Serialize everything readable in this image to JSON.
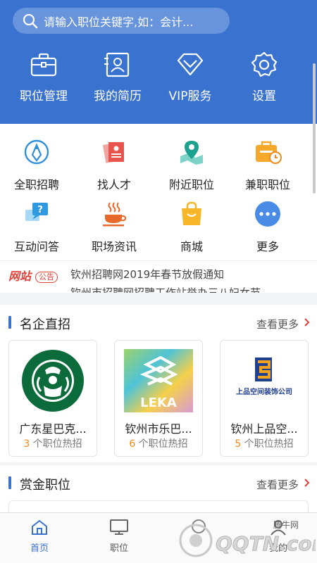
{
  "search": {
    "placeholder": "请输入职位关键字,如：会计..."
  },
  "top_nav": [
    {
      "label": "职位管理",
      "icon": "briefcase-icon"
    },
    {
      "label": "我的简历",
      "icon": "resume-icon"
    },
    {
      "label": "VIP服务",
      "icon": "diamond-icon"
    },
    {
      "label": "设置",
      "icon": "gear-icon"
    }
  ],
  "shortcuts": [
    {
      "label": "全职招聘",
      "icon": "fulltime-icon"
    },
    {
      "label": "找人才",
      "icon": "talent-icon"
    },
    {
      "label": "附近职位",
      "icon": "map-pin-icon"
    },
    {
      "label": "兼职职位",
      "icon": "parttime-icon"
    },
    {
      "label": "互动问答",
      "icon": "qa-icon"
    },
    {
      "label": "职场资讯",
      "icon": "coffee-icon"
    },
    {
      "label": "商城",
      "icon": "shopping-bag-icon"
    },
    {
      "label": "更多",
      "icon": "more-icon"
    }
  ],
  "notice": {
    "badge_main": "网站",
    "badge_sub": "公告",
    "text": "钦州招聘网2019年春节放假通知",
    "text_next": "钦州市招聘网招聘工作站举办三八妇女节"
  },
  "famous": {
    "title": "名企直招",
    "more": "查看更多",
    "companies": [
      {
        "name": "广东星巴克...",
        "count": "3",
        "suffix": " 个职位热招"
      },
      {
        "name": "钦州市乐巴...",
        "count": "6",
        "suffix": " 个职位热招"
      },
      {
        "name": "钦州上品空...",
        "count": "5",
        "suffix": " 个职位热招"
      }
    ],
    "logo_texts": {
      "leka": "LEKA",
      "shangpin": "上品空间装饰公司"
    }
  },
  "bounty": {
    "title": "赏金职位",
    "more": "查看更多"
  },
  "bottom_nav": [
    {
      "label": "首页",
      "active": true
    },
    {
      "label": "职位",
      "active": false
    },
    {
      "label": "",
      "active": false
    },
    {
      "label": "我的",
      "active": false
    }
  ],
  "watermark": {
    "cn": "腾牛网",
    "en": "QQTN.com"
  },
  "colors": {
    "primary": "#3a72d0",
    "accent": "#f28a18",
    "notice_red": "#e0413a"
  }
}
